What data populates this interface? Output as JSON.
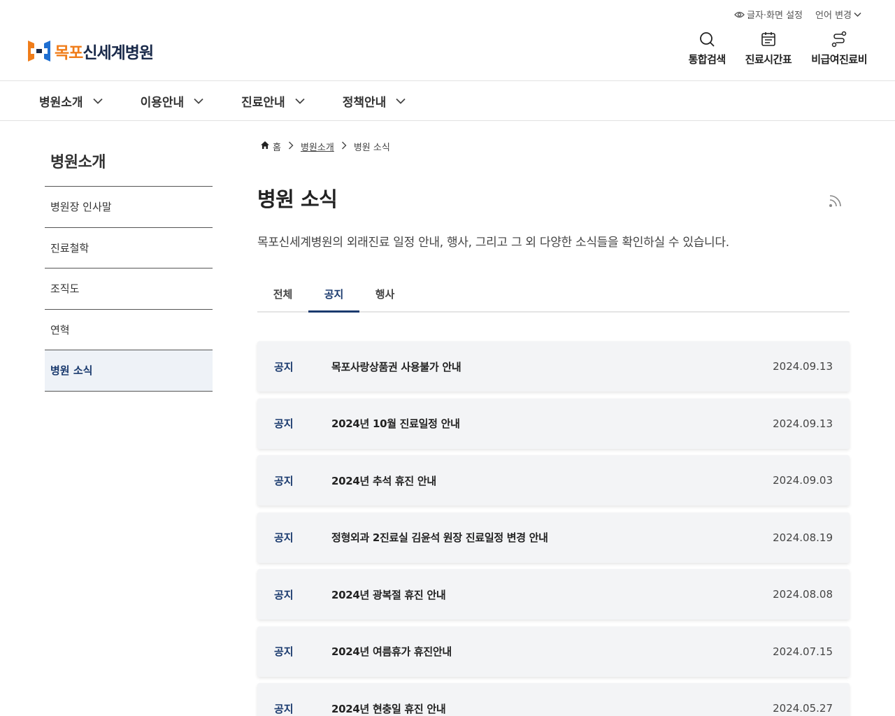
{
  "utility": {
    "display_settings": "글자·화면 설정",
    "language": "언어 변경"
  },
  "logo": {
    "part1": "목포",
    "part2": "신세계병원"
  },
  "quick_links": [
    {
      "label": "통합검색",
      "icon": "search-icon"
    },
    {
      "label": "진료시간표",
      "icon": "calendar-icon"
    },
    {
      "label": "비급여진료비",
      "icon": "cost-route-icon"
    }
  ],
  "gnb": [
    "병원소개",
    "이용안내",
    "진료안내",
    "정책안내"
  ],
  "sidebar": {
    "title": "병원소개",
    "items": [
      "병원장 인사말",
      "진료철학",
      "조직도",
      "연혁",
      "병원 소식"
    ],
    "active_index": 4
  },
  "breadcrumb": {
    "home": "홈",
    "level1": "병원소개",
    "level2": "병원 소식"
  },
  "page": {
    "title": "병원 소식",
    "description": "목포신세계병원의 외래진료 일정 안내, 행사, 그리고 그 외 다양한 소식들을 확인하실 수 있습니다."
  },
  "tabs": {
    "items": [
      "전체",
      "공지",
      "행사"
    ],
    "active_index": 1
  },
  "news": [
    {
      "category": "공지",
      "title": "목포사랑상품권 사용불가 안내",
      "date": "2024.09.13"
    },
    {
      "category": "공지",
      "title": "2024년 10월 진료일정 안내",
      "date": "2024.09.13"
    },
    {
      "category": "공지",
      "title": "2024년 추석 휴진 안내",
      "date": "2024.09.03"
    },
    {
      "category": "공지",
      "title": "정형외과 2진료실 김윤석 원장 진료일정 변경 안내",
      "date": "2024.08.19"
    },
    {
      "category": "공지",
      "title": "2024년 광복절 휴진 안내",
      "date": "2024.08.08"
    },
    {
      "category": "공지",
      "title": "2024년 여름휴가 휴진안내",
      "date": "2024.07.15"
    },
    {
      "category": "공지",
      "title": "2024년 현충일 휴진 안내",
      "date": "2024.05.27"
    }
  ],
  "colors": {
    "accent": "#1a3a6e",
    "brand_orange": "#f07d1a",
    "brand_blue": "#1f6fd1"
  }
}
